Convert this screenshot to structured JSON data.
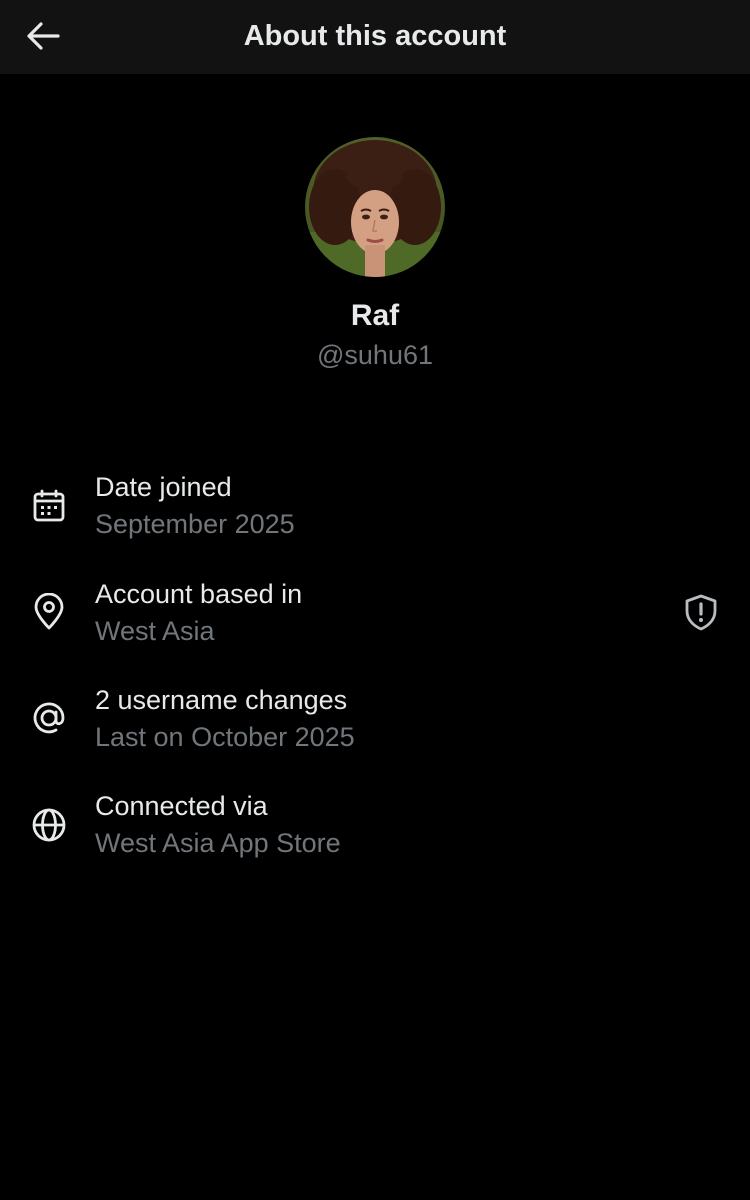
{
  "header": {
    "title": "About this account",
    "back_icon": "arrow-left-icon"
  },
  "profile": {
    "name": "Raf",
    "handle": "@suhu61",
    "avatar": "avatar-photo"
  },
  "colors": {
    "background": "#000000",
    "header_background": "#121212",
    "primary_text": "#e7e9ea",
    "secondary_text": "#71767b"
  },
  "details": [
    {
      "icon": "calendar-icon",
      "title": "Date joined",
      "value": "September 2025"
    },
    {
      "icon": "location-pin-icon",
      "title": "Account based in",
      "value": "West Asia",
      "badge_icon": "shield-exclamation-icon"
    },
    {
      "icon": "at-sign-icon",
      "title": "2 username changes",
      "value": "Last on October 2025"
    },
    {
      "icon": "globe-icon",
      "title": "Connected via",
      "value": "West Asia App Store"
    }
  ]
}
